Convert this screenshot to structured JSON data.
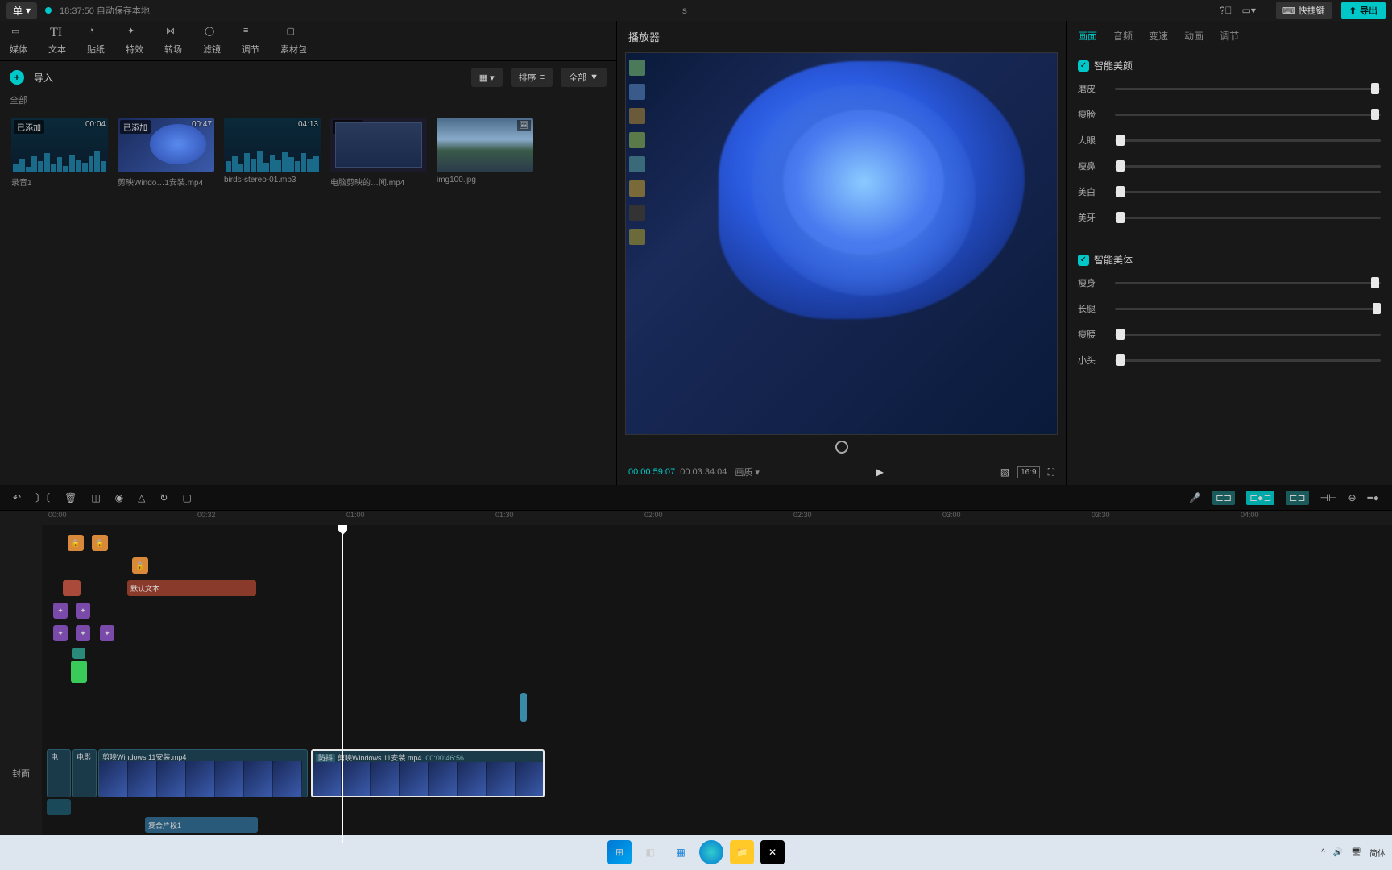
{
  "titlebar": {
    "menu": "单",
    "autosave": "18:37:50 自动保存本地",
    "project": "s",
    "shortcut": "快捷键",
    "export": "导出"
  },
  "tools": {
    "items": [
      {
        "label": "媒体",
        "icon": "media"
      },
      {
        "label": "文本",
        "icon": "text"
      },
      {
        "label": "贴纸",
        "icon": "sticker"
      },
      {
        "label": "特效",
        "icon": "fx"
      },
      {
        "label": "转场",
        "icon": "trans"
      },
      {
        "label": "滤镜",
        "icon": "filter"
      },
      {
        "label": "调节",
        "icon": "adjust"
      },
      {
        "label": "素材包",
        "icon": "pack"
      }
    ]
  },
  "media": {
    "import": "导入",
    "category": "全部",
    "view_sort": "排序",
    "view_all": "全部",
    "items": [
      {
        "name": "录音1",
        "dur": "00:04",
        "badge": "已添加",
        "type": "audio"
      },
      {
        "name": "剪映Windo…1安装.mp4",
        "dur": "00:47",
        "badge": "已添加",
        "type": "video"
      },
      {
        "name": "birds-stereo-01.mp3",
        "dur": "04:13",
        "badge": "",
        "type": "audio"
      },
      {
        "name": "电脑剪映的…闻.mp4",
        "dur": "",
        "badge": "已添加",
        "type": "video2"
      },
      {
        "name": "img100.jpg",
        "dur": "",
        "badge": "",
        "type": "image"
      }
    ]
  },
  "player": {
    "title": "播放器",
    "cur": "00:00:59:07",
    "tot": "00:03:34:04",
    "quality": "画质",
    "ratio": "16:9"
  },
  "props": {
    "tabs": [
      "画面",
      "音频",
      "变速",
      "动画",
      "调节"
    ],
    "active": 0,
    "sec1": {
      "title": "智能美颜",
      "sliders": [
        {
          "label": "磨皮",
          "val": 98
        },
        {
          "label": "瘦脸",
          "val": 98
        },
        {
          "label": "大眼",
          "val": 2
        },
        {
          "label": "瘦鼻",
          "val": 2
        },
        {
          "label": "美白",
          "val": 2
        },
        {
          "label": "美牙",
          "val": 2
        }
      ]
    },
    "sec2": {
      "title": "智能美体",
      "sliders": [
        {
          "label": "瘦身",
          "val": 98
        },
        {
          "label": "长腿",
          "val": 138
        },
        {
          "label": "瘦腰",
          "val": 2
        },
        {
          "label": "小头",
          "val": 2
        }
      ]
    }
  },
  "timeline": {
    "marks": [
      "00:00",
      "00:32",
      "01:00",
      "01:30",
      "02:00",
      "02:30",
      "03:00",
      "03:30",
      "04:00"
    ],
    "cover": "封面",
    "text_clip": "默认文本",
    "video1": {
      "name": "剪映Windows 11安装.mp4",
      "dur": "00:00:46:56",
      "stab": "防抖"
    },
    "video0": {
      "name": "剪映Windows 11安装.mp4"
    },
    "compound": "复合片段1"
  },
  "taskbar": {
    "ime": "简体"
  }
}
